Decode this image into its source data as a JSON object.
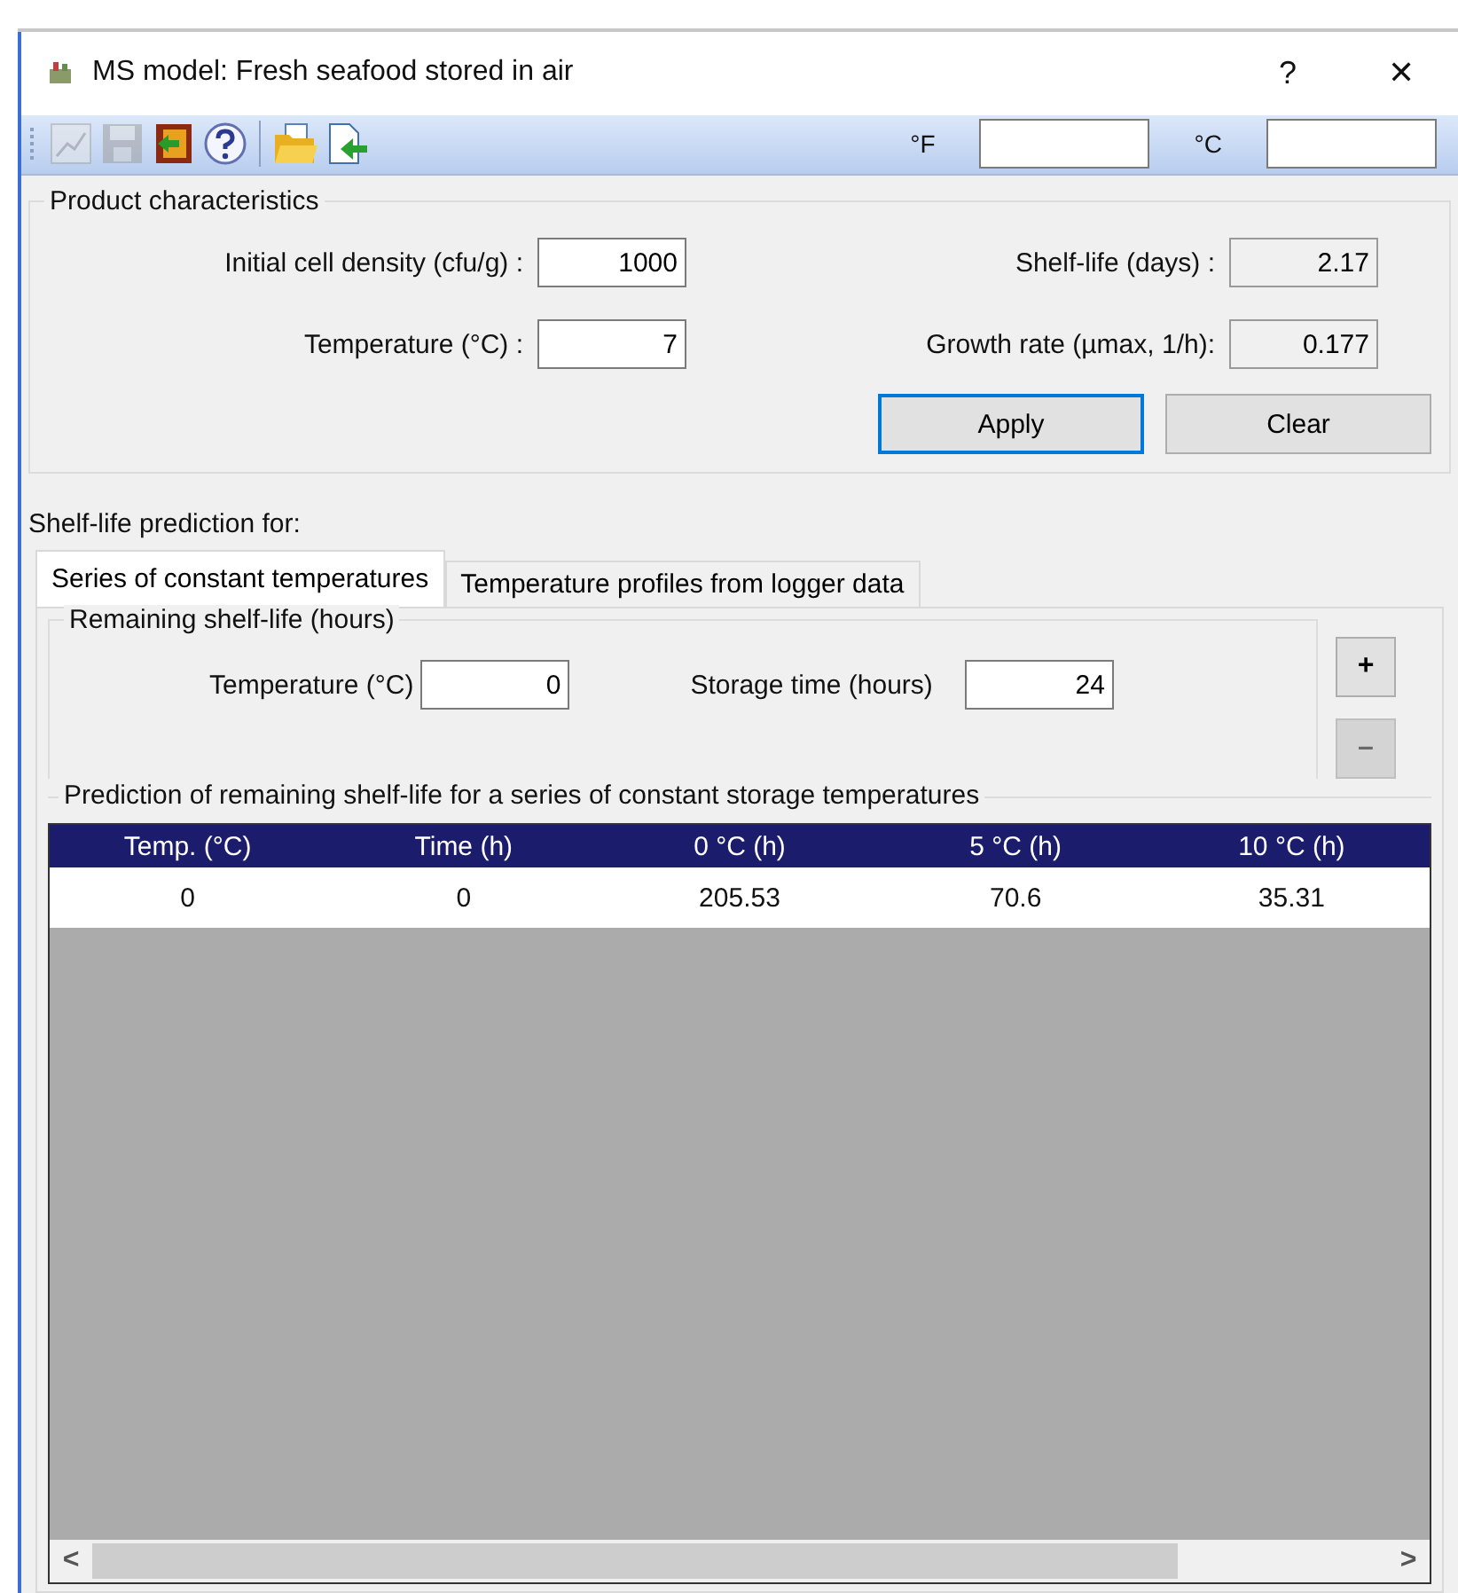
{
  "window": {
    "title": "MS model: Fresh seafood stored in air",
    "help": "?",
    "close": "✕"
  },
  "toolbar": {
    "tools": [
      {
        "kind": "chart",
        "disabled": true
      },
      {
        "kind": "save",
        "disabled": true
      },
      {
        "kind": "exit",
        "disabled": false
      },
      {
        "kind": "help",
        "disabled": false
      },
      {
        "kind": "sep"
      },
      {
        "kind": "open",
        "disabled": false
      },
      {
        "kind": "import",
        "disabled": false
      }
    ],
    "fahrenheit_label": "°F",
    "celsius_label": "°C"
  },
  "product": {
    "title": "Product characteristics",
    "inputs": [
      {
        "label": "Initial cell density (cfu/g) :",
        "value": "1000"
      },
      {
        "label": "Temperature (°C) :",
        "value": "7"
      }
    ],
    "outputs": [
      {
        "label": "Shelf-life (days) :",
        "value": "2.17"
      },
      {
        "label": "Growth rate (µmax, 1/h):",
        "value": "0.177"
      }
    ],
    "buttons": [
      {
        "label": "Apply",
        "focused": true
      },
      {
        "label": "Clear",
        "focused": false
      }
    ]
  },
  "prediction_label": "Shelf-life prediction for:",
  "tabs": [
    {
      "label": "Series of constant temperatures",
      "selected": true
    },
    {
      "label": "Temperature profiles from logger data",
      "selected": false
    }
  ],
  "remaining": {
    "title": "Remaining shelf-life (hours)",
    "fields": [
      {
        "label": "Temperature (°C)",
        "value": "0"
      },
      {
        "label": "Storage time (hours)",
        "value": "24"
      }
    ],
    "buttons": [
      {
        "label": "+",
        "disabled": false
      },
      {
        "label": "–",
        "disabled": true
      }
    ]
  },
  "table": {
    "title": "Prediction of remaining shelf-life for a series of constant storage temperatures",
    "columns": [
      "Temp. (°C)",
      "Time (h)",
      "0 °C (h)",
      "5 °C (h)",
      "10 °C (h)"
    ],
    "rows": [
      [
        "0",
        "0",
        "205.53",
        "70.6",
        "35.31"
      ]
    ],
    "scroll_left": "<",
    "scroll_right": ">"
  }
}
